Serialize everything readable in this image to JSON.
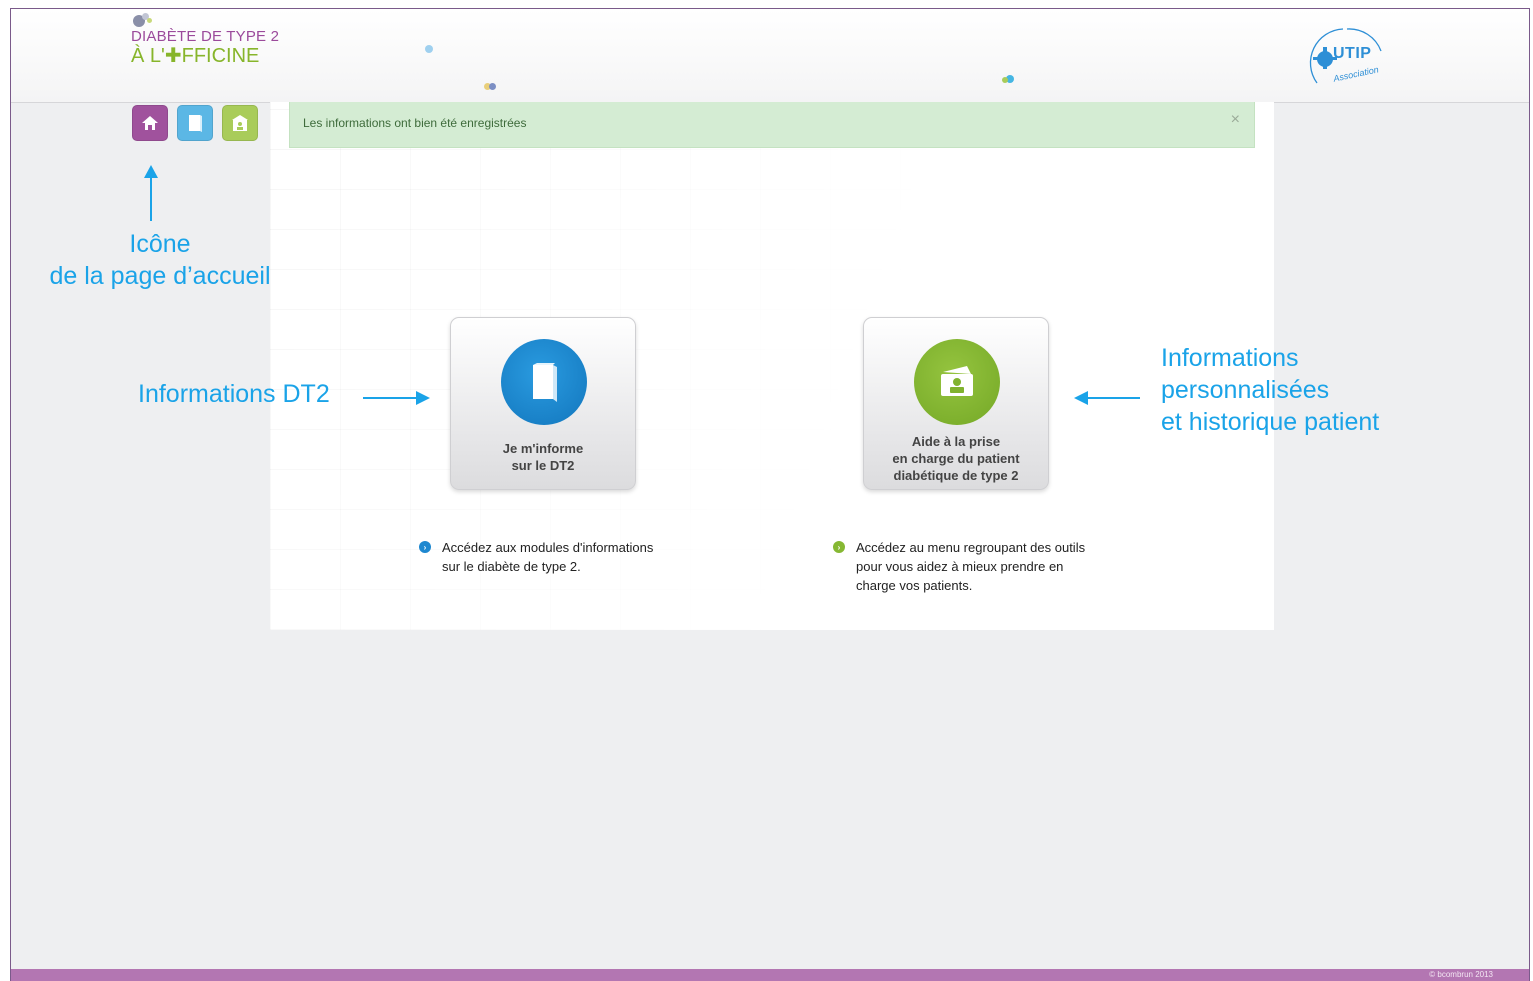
{
  "header": {
    "logo": {
      "line1": "DIABÈTE DE TYPE 2",
      "line2": "À L'✚FFICINE"
    },
    "partner_logo": {
      "name": "UTIP",
      "subtitle": "Association"
    }
  },
  "nav": {
    "items": [
      {
        "name": "home",
        "icon": "home-icon",
        "color": "#a0529d"
      },
      {
        "name": "informations",
        "icon": "book-icon",
        "color": "#5bb7e5"
      },
      {
        "name": "aide",
        "icon": "patient-card-icon",
        "color": "#a9cc5a"
      }
    ]
  },
  "alert": {
    "message": "Les informations ont bien été enregistrées",
    "close": "×"
  },
  "cards": [
    {
      "label_lines": [
        "Je m'informe",
        "sur le DT2"
      ],
      "icon": "book-icon",
      "color": "#1e88d0"
    },
    {
      "label_lines": [
        "Aide à la prise",
        "en charge du patient",
        "diabétique de type 2"
      ],
      "icon": "patient-card-icon",
      "color": "#86b833"
    }
  ],
  "bullets": [
    {
      "lines": [
        "Accédez aux modules d'informations",
        "sur le diabète de type 2."
      ],
      "color": "#1e88d0"
    },
    {
      "lines": [
        "Accédez au menu regroupant des outils",
        "pour vous aidez à mieux prendre en",
        "charge vos patients."
      ],
      "color": "#86b833"
    }
  ],
  "annotations": {
    "home": [
      "Icône",
      "de la page d’accueil"
    ],
    "info": "Informations DT2",
    "perso": [
      "Informations",
      "personnalisées",
      "et historique patient"
    ]
  },
  "footer": {
    "text": "© bcombrun 2013"
  }
}
